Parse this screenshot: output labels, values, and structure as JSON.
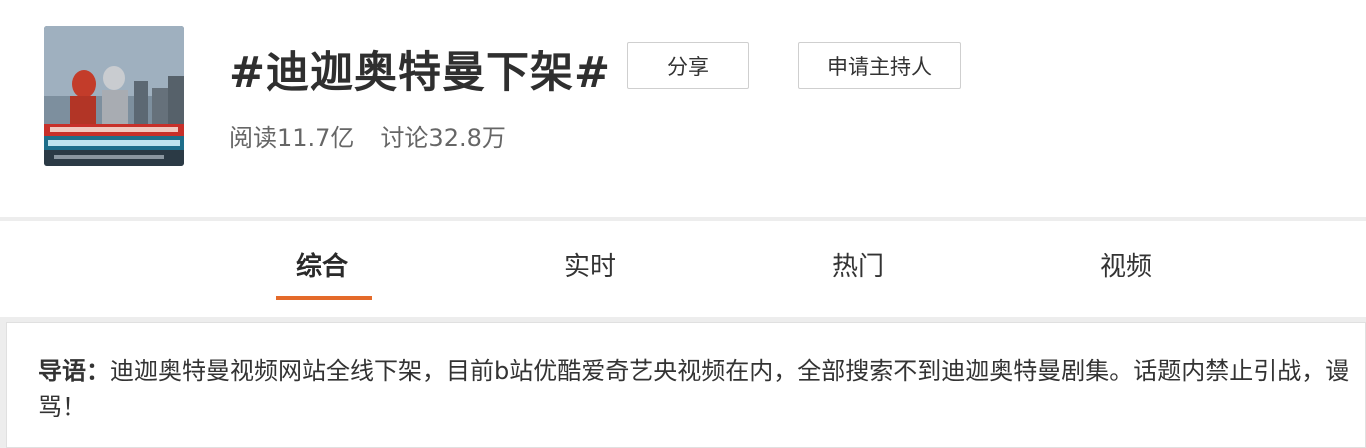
{
  "topic": {
    "title": "#迪迦奥特曼下架#",
    "thumbnail_icon": "video-thumbnail-image"
  },
  "actions": {
    "share_label": "分享",
    "host_label": "申请主持人"
  },
  "stats": {
    "reads": "阅读11.7亿",
    "discussions": "讨论32.8万"
  },
  "tabs": [
    {
      "label": "综合",
      "active": true
    },
    {
      "label": "实时",
      "active": false
    },
    {
      "label": "热门",
      "active": false
    },
    {
      "label": "视频",
      "active": false
    }
  ],
  "intro": {
    "lead": "导语：",
    "text": "迪迦奥特曼视频网站全线下架，目前b站优酷爱奇艺央视频在内，全部搜索不到迪迦奥特曼剧集。话题内禁止引战，谩骂！"
  },
  "colors": {
    "accent": "#e46a2a",
    "background": "#ededed"
  }
}
